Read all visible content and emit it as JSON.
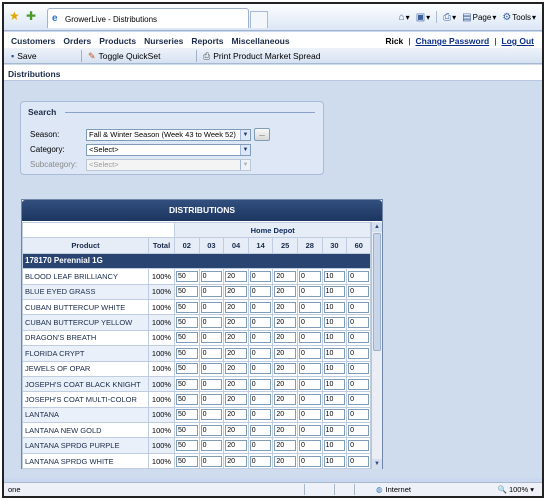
{
  "browser": {
    "tab_title": "GrowerLive - Distributions",
    "tools": {
      "page_label": "Page",
      "tools_label": "Tools"
    },
    "status": {
      "done": "one",
      "zone": "Internet",
      "zoom": "100%"
    }
  },
  "menu": {
    "items": [
      "Customers",
      "Orders",
      "Products",
      "Nurseries",
      "Reports",
      "Miscellaneous"
    ],
    "user_name": "Rick",
    "change_password": "Change Password",
    "log_out": "Log Out"
  },
  "toolbar": {
    "save_label": "Save",
    "quickset_label": "Toggle QuickSet",
    "print_label": "Print Product Market Spread"
  },
  "breadcrumb": "Distributions",
  "search": {
    "legend": "Search",
    "season_label": "Season:",
    "season_value": "Fall & Winter Season (Week 43 to Week 52)",
    "category_label": "Category:",
    "category_value": "<Select>",
    "subcategory_label": "Subcategory:",
    "subcategory_value": "<Select>",
    "browse_label": "..."
  },
  "grid": {
    "title": "DISTRIBUTIONS",
    "customer_group": "Home Depot",
    "col_product": "Product",
    "col_total": "Total",
    "stores": [
      "02",
      "03",
      "04",
      "14",
      "25",
      "28",
      "30",
      "60"
    ],
    "group_header": "178170 Perennial 1G",
    "rows": [
      {
        "name": "BLOOD LEAF BRILLIANCY",
        "total": "100%",
        "values": [
          "50",
          "0",
          "20",
          "0",
          "20",
          "0",
          "10",
          "0"
        ]
      },
      {
        "name": "BLUE EYED GRASS",
        "total": "100%",
        "values": [
          "50",
          "0",
          "20",
          "0",
          "20",
          "0",
          "10",
          "0"
        ]
      },
      {
        "name": "CUBAN BUTTERCUP WHITE",
        "total": "100%",
        "values": [
          "50",
          "0",
          "20",
          "0",
          "20",
          "0",
          "10",
          "0"
        ]
      },
      {
        "name": "CUBAN BUTTERCUP YELLOW",
        "total": "100%",
        "values": [
          "50",
          "0",
          "20",
          "0",
          "20",
          "0",
          "10",
          "0"
        ]
      },
      {
        "name": "DRAGON'S BREATH",
        "total": "100%",
        "values": [
          "50",
          "0",
          "20",
          "0",
          "20",
          "0",
          "10",
          "0"
        ]
      },
      {
        "name": "FLORIDA CRYPT",
        "total": "100%",
        "values": [
          "50",
          "0",
          "20",
          "0",
          "20",
          "0",
          "10",
          "0"
        ]
      },
      {
        "name": "JEWELS OF OPAR",
        "total": "100%",
        "values": [
          "50",
          "0",
          "20",
          "0",
          "20",
          "0",
          "10",
          "0"
        ]
      },
      {
        "name": "JOSEPH'S COAT BLACK KNIGHT",
        "total": "100%",
        "values": [
          "50",
          "0",
          "20",
          "0",
          "20",
          "0",
          "10",
          "0"
        ]
      },
      {
        "name": "JOSEPH'S COAT MULTI-COLOR",
        "total": "100%",
        "values": [
          "50",
          "0",
          "20",
          "0",
          "20",
          "0",
          "10",
          "0"
        ]
      },
      {
        "name": "LANTANA",
        "total": "100%",
        "values": [
          "50",
          "0",
          "20",
          "0",
          "20",
          "0",
          "10",
          "0"
        ]
      },
      {
        "name": "LANTANA NEW GOLD",
        "total": "100%",
        "values": [
          "50",
          "0",
          "20",
          "0",
          "20",
          "0",
          "10",
          "0"
        ]
      },
      {
        "name": "LANTANA SPRDG PURPLE",
        "total": "100%",
        "values": [
          "50",
          "0",
          "20",
          "0",
          "20",
          "0",
          "10",
          "0"
        ]
      },
      {
        "name": "LANTANA SPRDG WHITE",
        "total": "100%",
        "values": [
          "50",
          "0",
          "20",
          "0",
          "20",
          "0",
          "10",
          "0"
        ]
      }
    ]
  },
  "colors": {
    "grid_header": "#1c3660",
    "group_row": "#2a4472",
    "link": "#0b2e8a",
    "page_bg": "#cfdcee"
  }
}
